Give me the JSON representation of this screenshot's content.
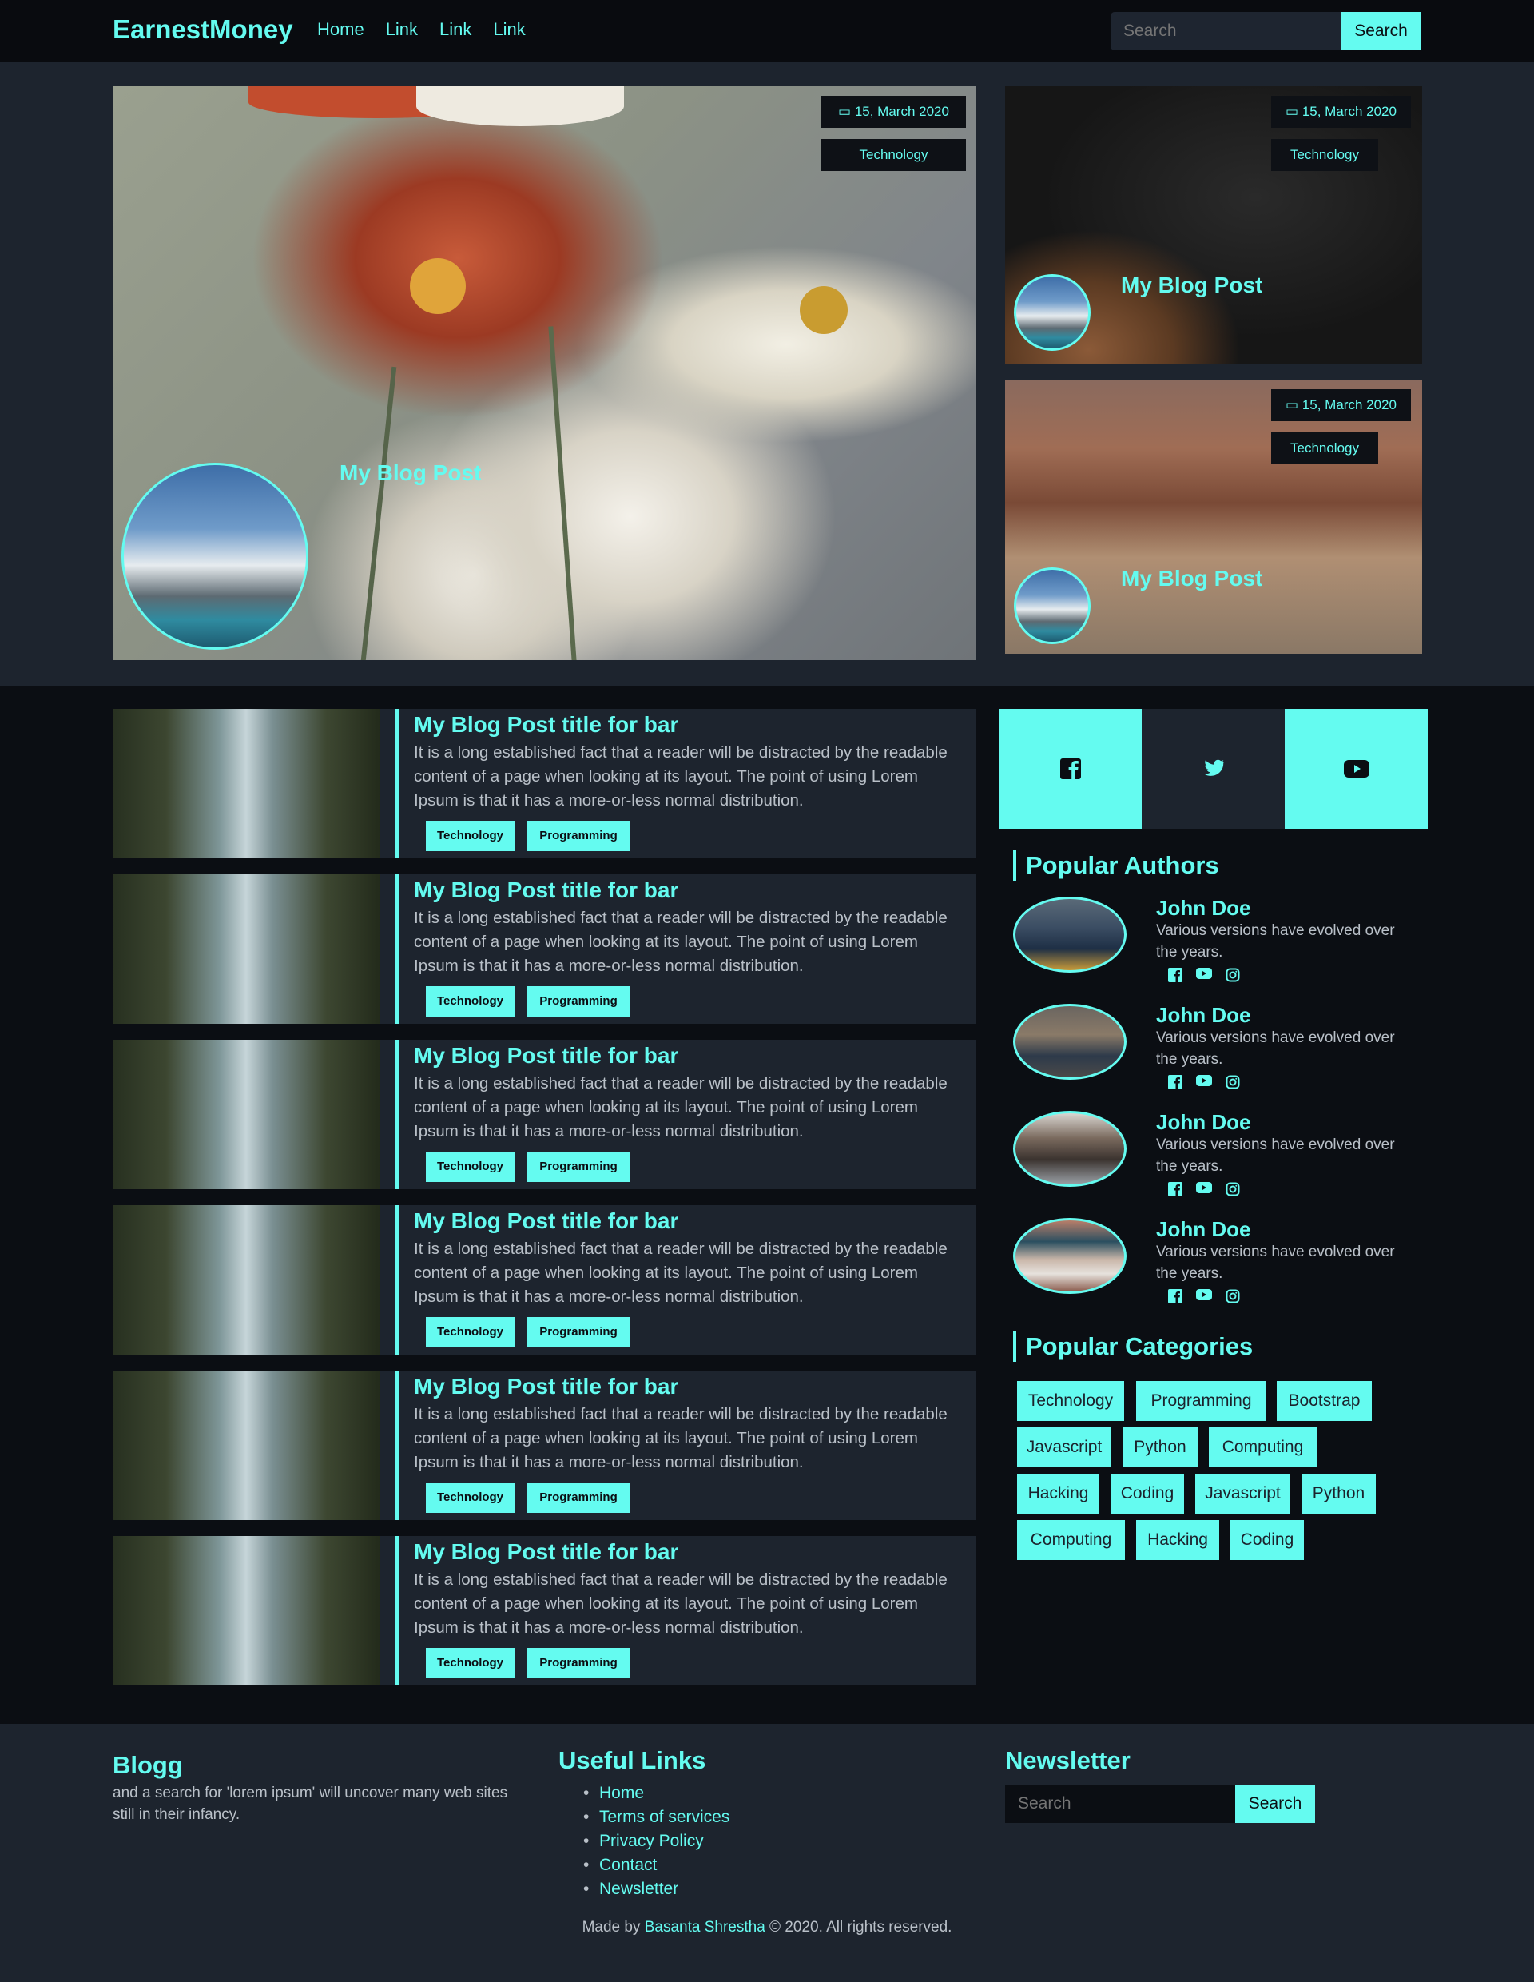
{
  "nav": {
    "brand": "EarnestMoney",
    "links": [
      "Home",
      "Link",
      "Link",
      "Link"
    ],
    "search_placeholder": "Search",
    "search_button": "Search"
  },
  "hero": {
    "main": {
      "date": "15, March 2020",
      "category": "Technology",
      "title": "My Blog Post"
    },
    "side": [
      {
        "date": "15, March 2020",
        "category": "Technology",
        "title": "My Blog Post"
      },
      {
        "date": "15, March 2020",
        "category": "Technology",
        "title": "My Blog Post"
      }
    ]
  },
  "posts": [
    {
      "title": "My Blog Post title for bar",
      "text": "It is a long established fact that a reader will be distracted by the readable content of a page when looking at its layout. The point of using Lorem Ipsum is that it has a more-or-less normal distribution.",
      "tags": [
        "Technology",
        "Programming"
      ]
    },
    {
      "title": "My Blog Post title for bar",
      "text": "It is a long established fact that a reader will be distracted by the readable content of a page when looking at its layout. The point of using Lorem Ipsum is that it has a more-or-less normal distribution.",
      "tags": [
        "Technology",
        "Programming"
      ]
    },
    {
      "title": "My Blog Post title for bar",
      "text": "It is a long established fact that a reader will be distracted by the readable content of a page when looking at its layout. The point of using Lorem Ipsum is that it has a more-or-less normal distribution.",
      "tags": [
        "Technology",
        "Programming"
      ]
    },
    {
      "title": "My Blog Post title for bar",
      "text": "It is a long established fact that a reader will be distracted by the readable content of a page when looking at its layout. The point of using Lorem Ipsum is that it has a more-or-less normal distribution.",
      "tags": [
        "Technology",
        "Programming"
      ]
    },
    {
      "title": "My Blog Post title for bar",
      "text": "It is a long established fact that a reader will be distracted by the readable content of a page when looking at its layout. The point of using Lorem Ipsum is that it has a more-or-less normal distribution.",
      "tags": [
        "Technology",
        "Programming"
      ]
    },
    {
      "title": "My Blog Post title for bar",
      "text": "It is a long established fact that a reader will be distracted by the readable content of a page when looking at its layout. The point of using Lorem Ipsum is that it has a more-or-less normal distribution.",
      "tags": [
        "Technology",
        "Programming"
      ]
    }
  ],
  "social": [
    "facebook-icon",
    "twitter-icon",
    "youtube-icon"
  ],
  "popular_authors": {
    "heading": "Popular Authors",
    "authors": [
      {
        "name": "John Doe",
        "desc": "Various versions have evolved over the years."
      },
      {
        "name": "John Doe",
        "desc": "Various versions have evolved over the years."
      },
      {
        "name": "John Doe",
        "desc": "Various versions have evolved over the years."
      },
      {
        "name": "John Doe",
        "desc": "Various versions have evolved over the years."
      }
    ]
  },
  "popular_categories": {
    "heading": "Popular Categories",
    "items": [
      "Technology",
      "Programming",
      "Bootstrap",
      "Javascript",
      "Python",
      "Computing",
      "Hacking",
      "Coding",
      "Javascript",
      "Python",
      "Computing",
      "Hacking",
      "Coding"
    ]
  },
  "footer": {
    "brand": "Blogg",
    "brand_text": "and a search for 'lorem ipsum' will uncover many web sites still in their infancy.",
    "links_heading": "Useful Links",
    "links": [
      "Home",
      "Terms of services",
      "Privacy Policy",
      "Contact",
      "Newsletter"
    ],
    "newsletter_heading": "Newsletter",
    "newsletter_placeholder": "Search",
    "newsletter_button": "Search",
    "credit_prefix": "Made by ",
    "credit_author": "Basanta Shrestha",
    "credit_suffix": " © 2020. All rights reserved."
  },
  "colors": {
    "accent": "#64fbf0",
    "dark": "#0b0e13",
    "panel": "#1d242e"
  }
}
